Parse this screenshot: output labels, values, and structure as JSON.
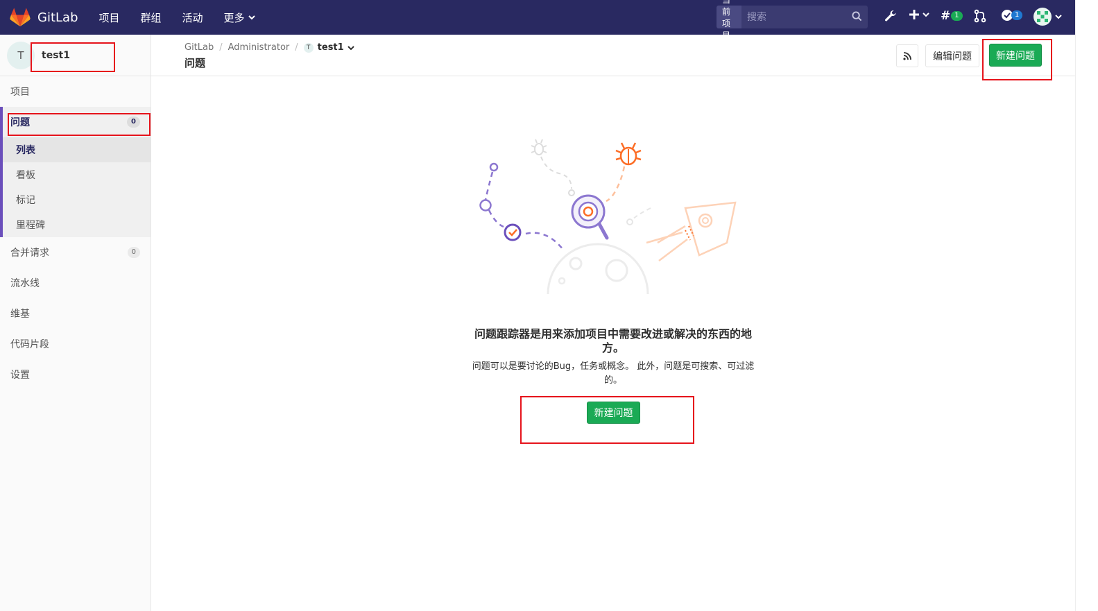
{
  "topbar": {
    "brand": "GitLab",
    "nav": [
      "项目",
      "群组",
      "活动",
      "更多"
    ],
    "search": {
      "scope": "当前项目",
      "placeholder": "搜索"
    },
    "issues_badge": "1",
    "todos_badge": "1"
  },
  "sidebar": {
    "project": {
      "avatar_letter": "T",
      "name": "test1"
    },
    "items": {
      "project": "项目",
      "issues": {
        "label": "问题",
        "count": "0"
      },
      "merge_requests": {
        "label": "合并请求",
        "count": "0"
      },
      "pipelines": "流水线",
      "wiki": "维基",
      "snippets": "代码片段",
      "settings": "设置"
    },
    "issues_sub": [
      "列表",
      "看板",
      "标记",
      "里程碑"
    ]
  },
  "header": {
    "breadcrumb": [
      "GitLab",
      "Administrator",
      "test1"
    ],
    "crumb_avatar": "T",
    "title": "问题",
    "edit_button": "编辑问题",
    "new_button": "新建问题"
  },
  "empty_state": {
    "title": "问题跟踪器是用来添加项目中需要改进或解决的东西的地方。",
    "text": "问题可以是要讨论的Bug，任务或概念。 此外，问题是可搜索、可过滤的。",
    "button": "新建问题"
  },
  "colors": {
    "topbar": "#292961",
    "accent": "#6b4fbb",
    "success": "#1aaa55",
    "annotation": "#e6131b"
  }
}
